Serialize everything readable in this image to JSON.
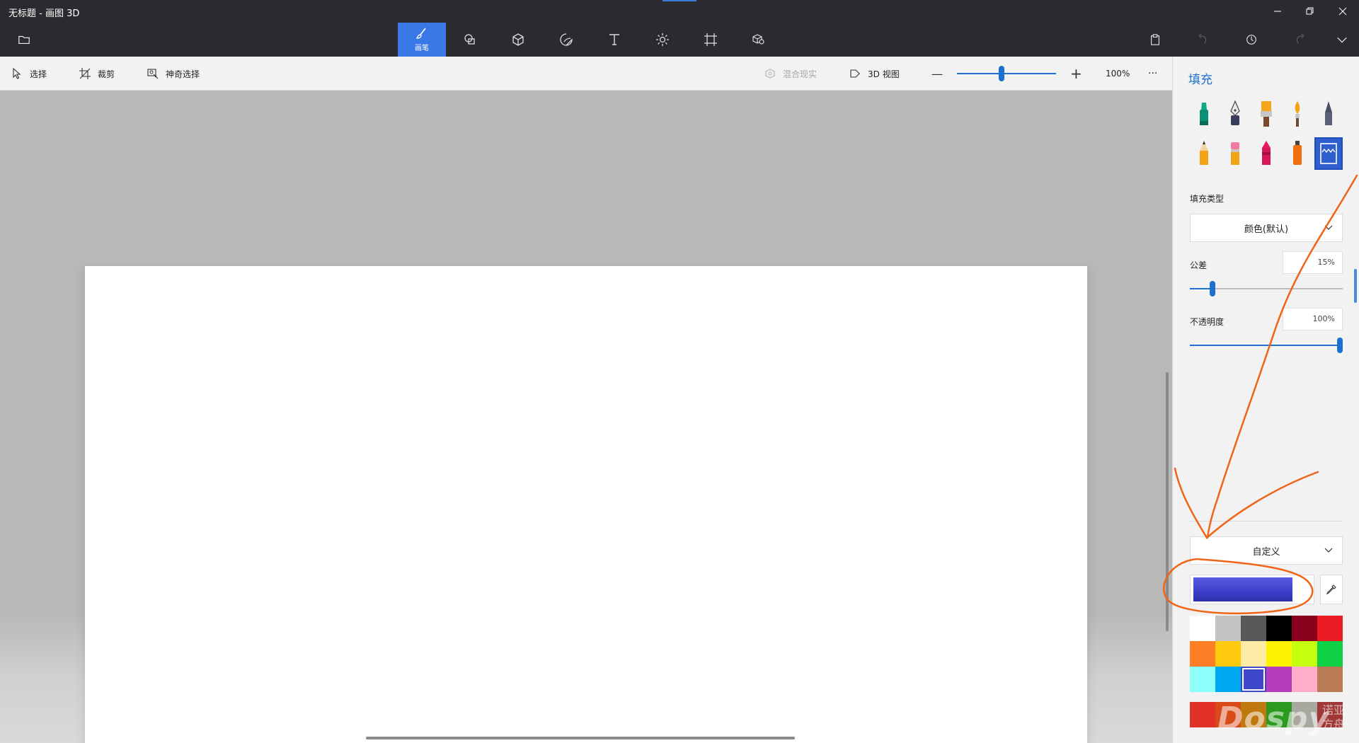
{
  "window": {
    "title": "无标题 - 画图 3D",
    "minimize": "—",
    "maximize": "❐",
    "close": "✕"
  },
  "toolbar": {
    "brushes_label": "画笔",
    "tools": [
      "brush-icon",
      "shapes-2d-icon",
      "shapes-3d-icon",
      "stickers-icon",
      "text-icon",
      "effects-icon",
      "canvas-icon",
      "library-3d-icon"
    ],
    "right_icons": [
      "paste-icon",
      "undo-icon",
      "history-icon",
      "redo-icon",
      "chevron-down-icon"
    ]
  },
  "subbar": {
    "select": "选择",
    "crop": "裁剪",
    "magic_select": "神奇选择",
    "mixed_reality": "混合现实",
    "view_3d": "3D 视图",
    "zoom_out": "—",
    "zoom_in": "+",
    "zoom": "100%",
    "zoom_fraction": 0.45,
    "more": "···"
  },
  "panel": {
    "title": "填充",
    "brushes": [
      "marker",
      "calligraphy-pen",
      "oil-brush",
      "watercolor",
      "pixel-pen",
      "pencil",
      "eraser",
      "crayon",
      "spray-can",
      "fill"
    ],
    "fill_type_label": "填充类型",
    "fill_type_value": "颜色(默认)",
    "tolerance_label": "公差",
    "tolerance_value": "15%",
    "tolerance_fraction": 0.15,
    "opacity_label": "不透明度",
    "opacity_value": "100%",
    "opacity_fraction": 1.0,
    "custom_label": "自定义",
    "current_color": "#3b3fc8",
    "palette": [
      "#ffffff",
      "#c3c3c3",
      "#585858",
      "#000000",
      "#88001b",
      "#ec1c24",
      "#ff7f27",
      "#ffc90e",
      "#fdeca6",
      "#fff200",
      "#c4ff0e",
      "#0ed145",
      "#8cfffb",
      "#00a8f3",
      "#3f48cc",
      "#b83dba",
      "#ffaec8",
      "#b97a56"
    ],
    "palette_row2": [
      "#e03028",
      "#d84a18",
      "#c07810",
      "#2c9a20",
      "#a8a8a0",
      "#a03838"
    ],
    "selected_color_index": 14
  },
  "watermark": {
    "main": "Dospy",
    "sub": "诺亚方舟"
  },
  "accent": "#1f6fd1"
}
